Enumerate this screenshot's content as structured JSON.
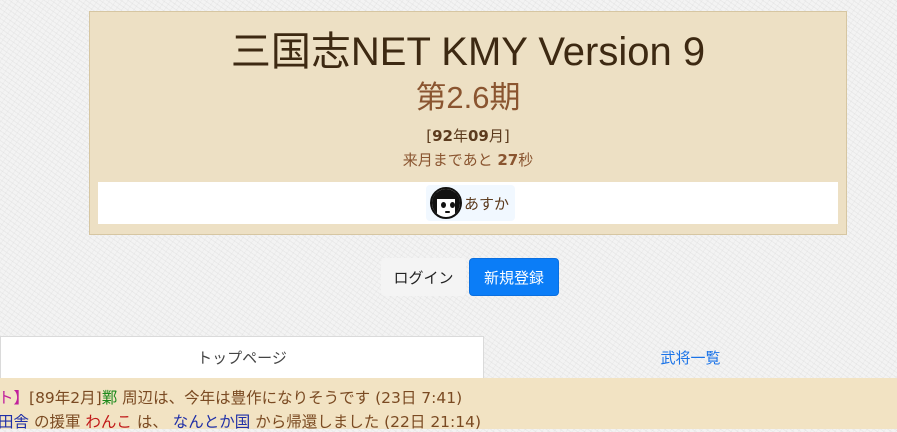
{
  "header": {
    "title": "三国志NET KMY Version 9",
    "period": "第2.6期",
    "date": {
      "open": "[",
      "year": "92",
      "year_unit": "年",
      "month": "09",
      "month_unit": "月]"
    },
    "countdown": {
      "prefix": "来月まであと ",
      "seconds": "27",
      "suffix": "秒"
    }
  },
  "online_users": [
    {
      "name": "あすか",
      "avatar_icon": "girl-face-icon"
    }
  ],
  "actions": {
    "login_label": "ログイン",
    "register_label": "新規登録"
  },
  "tabs": {
    "top_page": "トップページ",
    "generals_list": "武将一覧"
  },
  "log": {
    "line1": {
      "lead": "ト】",
      "date": "[89年2月]",
      "place": "鄴",
      "text": " 周辺は、今年は豊作になりそうです (23日 7:41)"
    },
    "line2": {
      "country": "田舎",
      "t1": " の援軍 ",
      "who": "わんこ",
      "t2": " は、 ",
      "from": "なんとか国",
      "t3": " から帰還しました (22日 21:14)"
    }
  },
  "colors": {
    "brand_blue": "#0b7df7",
    "header_bg": "#ede0c4",
    "log_bg": "#f2e3c3"
  }
}
